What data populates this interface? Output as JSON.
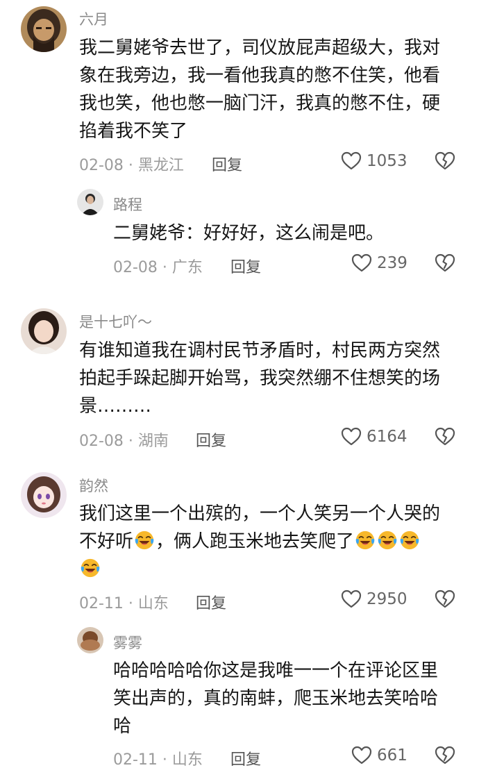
{
  "comments": [
    {
      "name": "六月",
      "lines": [
        "我二舅姥爷去世了，司仪放屁声超级大，我对",
        "象在我旁边，我一看他我真的憋不住笑，他看",
        "我也笑，他也憋一脑门汗，我真的憋不住，硬",
        "掐着我不笑了"
      ],
      "meta": "02-08 · 黑龙江",
      "reply": "回复",
      "likes": "1053"
    },
    {
      "name": "路程",
      "lines": [
        "二舅姥爷：好好好，这么闹是吧。"
      ],
      "meta": "02-08 · 广东",
      "reply": "回复",
      "likes": "239"
    },
    {
      "name": "是十七吖～",
      "lines": [
        "有谁知道我在调村民节矛盾时，村民两方突然",
        "拍起手跺起脚开始骂，我突然绷不住想笑的场",
        "景………"
      ],
      "meta": "02-08 · 湖南",
      "reply": "回复",
      "likes": "6164"
    },
    {
      "name": "韵然",
      "line1": "我们这里一个出殡的，一个人笑另一个人哭的",
      "line2a": "不好听",
      "line2b": "，俩人跑玉米地去笑爬了",
      "meta": "02-11 · 山东",
      "reply": "回复",
      "likes": "2950"
    },
    {
      "name": "雾雾",
      "lines": [
        "哈哈哈哈哈你这是我唯一一个在评论区里",
        "笑出声的，真的南蚌，爬玉米地去笑哈哈",
        "哈"
      ],
      "meta": "02-11 · 山东",
      "reply": "回复",
      "likes": "661"
    }
  ],
  "icons": {
    "like": "heart-outline-icon",
    "dislike": "broken-heart-outline-icon",
    "emoji": "laughing-crying-emoji"
  },
  "colors": {
    "name": "#8a8a8a",
    "text": "#161616",
    "meta": "#9b9b9b"
  }
}
